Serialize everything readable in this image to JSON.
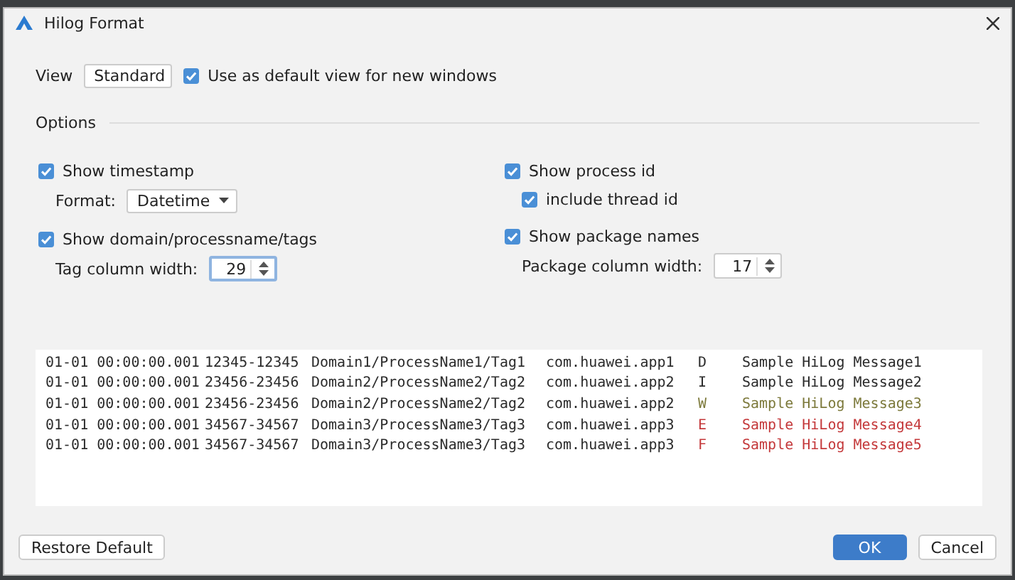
{
  "window": {
    "title": "Hilog Format"
  },
  "view": {
    "label": "View",
    "value": "Standard",
    "default_checkbox": {
      "label": "Use as default view for new windows",
      "checked": true
    }
  },
  "options": {
    "title": "Options",
    "columns": [
      [
        {
          "kind": "checkbox",
          "label": "Show timestamp",
          "checked": true,
          "children": [
            {
              "kind": "select",
              "label": "Format:",
              "value": "Datetime"
            }
          ]
        },
        {
          "kind": "checkbox",
          "label": "Show domain/processname/tags",
          "checked": true,
          "children": [
            {
              "kind": "spinner",
              "label": "Tag column width:",
              "value": "29",
              "focused": true
            }
          ]
        }
      ],
      [
        {
          "kind": "checkbox",
          "label": "Show process id",
          "checked": true,
          "children": [
            {
              "kind": "checkbox",
              "label": "include thread id",
              "checked": true
            }
          ]
        },
        {
          "kind": "checkbox",
          "label": "Show package names",
          "checked": true,
          "children": [
            {
              "kind": "spinner",
              "label": "Package column width:",
              "value": "17",
              "focused": false
            }
          ]
        }
      ]
    ]
  },
  "log": [
    {
      "timestamp": "01-01 00:00:00.001",
      "pid": "12345-12345",
      "tag": "Domain1/ProcessName1/Tag1",
      "package": "com.huawei.app1",
      "level": "D",
      "message": "Sample HiLog Message1",
      "color": "#2b2b2b"
    },
    {
      "timestamp": "01-01 00:00:00.001",
      "pid": "23456-23456",
      "tag": "Domain2/ProcessName2/Tag2",
      "package": "com.huawei.app2",
      "level": "I",
      "message": "Sample HiLog Message2",
      "color": "#2b2b2b"
    },
    {
      "timestamp": "01-01 00:00:00.001",
      "pid": "23456-23456",
      "tag": "Domain2/ProcessName2/Tag2",
      "package": "com.huawei.app2",
      "level": "W",
      "message": "Sample HiLog Message3",
      "color": "#7d7a3c"
    },
    {
      "timestamp": "01-01 00:00:00.001",
      "pid": "34567-34567",
      "tag": "Domain3/ProcessName3/Tag3",
      "package": "com.huawei.app3",
      "level": "E",
      "message": "Sample HiLog Message4",
      "color": "#c4393b"
    },
    {
      "timestamp": "01-01 00:00:00.001",
      "pid": "34567-34567",
      "tag": "Domain3/ProcessName3/Tag3",
      "package": "com.huawei.app3",
      "level": "F",
      "message": "Sample HiLog Message5",
      "color": "#c4393b"
    }
  ],
  "buttons": [
    {
      "label": "Restore Default",
      "kind": "default"
    },
    {
      "label": "OK",
      "kind": "primary"
    },
    {
      "label": "Cancel",
      "kind": "secondary"
    }
  ]
}
